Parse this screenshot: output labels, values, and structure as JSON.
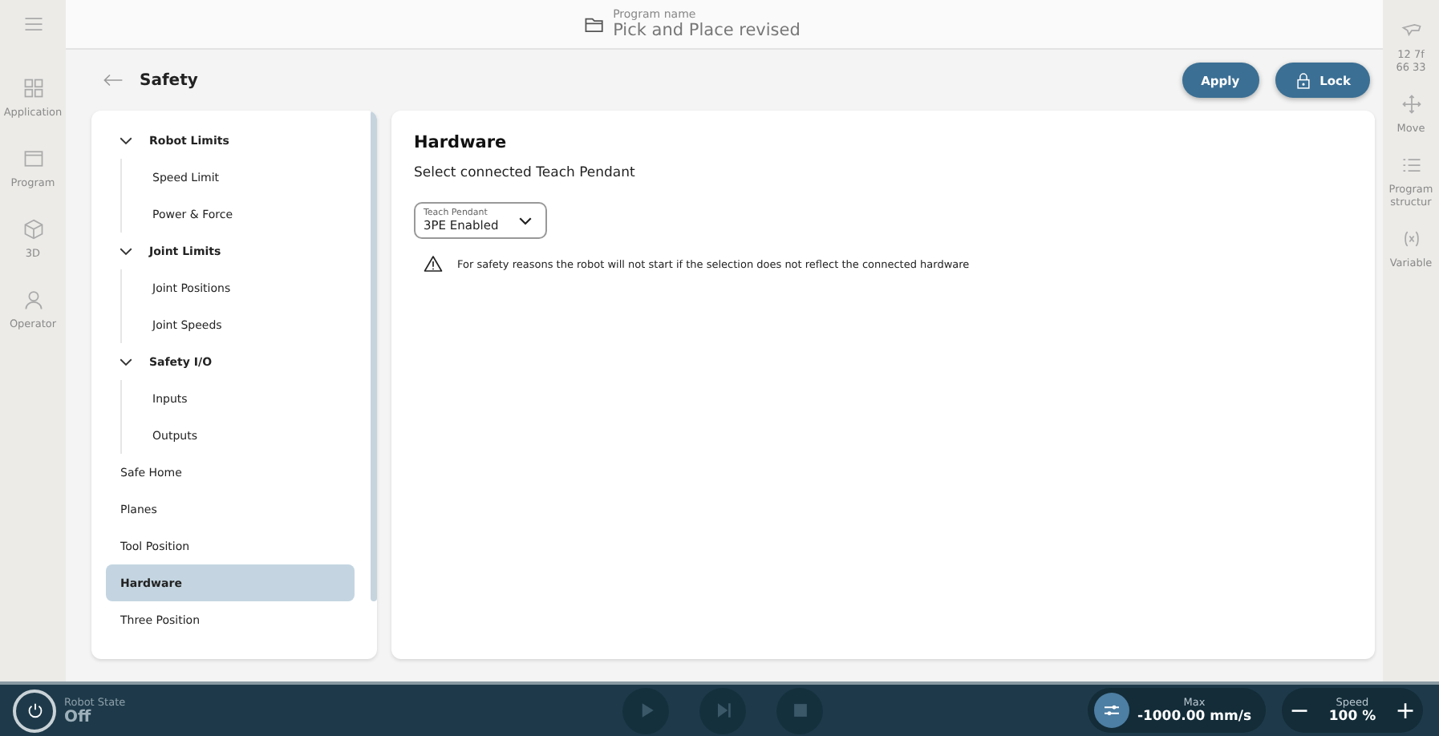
{
  "left_rail": [
    {
      "label": "Application"
    },
    {
      "label": "Program"
    },
    {
      "label": "3D"
    },
    {
      "label": "Operator"
    }
  ],
  "program": {
    "caption": "Program name",
    "name": "Pick and Place revised"
  },
  "page": {
    "title": "Safety"
  },
  "actions": [
    {
      "label": "Apply"
    },
    {
      "label": "Lock"
    }
  ],
  "nav": [
    {
      "label": "Robot Limits",
      "expanded": true,
      "selected": false,
      "children": [
        {
          "label": "Speed Limit",
          "selected": false
        },
        {
          "label": "Power & Force",
          "selected": false
        }
      ]
    },
    {
      "label": "Joint Limits",
      "expanded": true,
      "selected": false,
      "children": [
        {
          "label": "Joint Positions",
          "selected": false
        },
        {
          "label": "Joint Speeds",
          "selected": false
        }
      ]
    },
    {
      "label": "Safety I/O",
      "expanded": true,
      "selected": false,
      "children": [
        {
          "label": "Inputs",
          "selected": false
        },
        {
          "label": "Outputs",
          "selected": false
        }
      ]
    },
    {
      "label": "Safe Home",
      "selected": false
    },
    {
      "label": "Planes",
      "selected": false
    },
    {
      "label": "Tool Position",
      "selected": false
    },
    {
      "label": "Hardware",
      "selected": true
    },
    {
      "label": "Three Position",
      "selected": false
    }
  ],
  "content": {
    "title": "Hardware",
    "subtitle": "Select connected Teach Pendant",
    "dropdown": {
      "label": "Teach Pendant",
      "value": "3PE Enabled"
    },
    "warning": "For safety reasons the robot will not start if the selection does not reflect the connected hardware"
  },
  "right_rail": [
    {
      "label": "12 7f\n66 33"
    },
    {
      "label": "Move"
    },
    {
      "label": "Program\nstructur"
    },
    {
      "label": "Variable"
    }
  ],
  "status_bar": {
    "robot_state_label": "Robot State",
    "robot_state": "Off",
    "max_label": "Max",
    "max_value": "-1000.00 mm/s",
    "speed_label": "Speed",
    "speed_value": "100 %",
    "minus": "−",
    "plus": "+"
  }
}
